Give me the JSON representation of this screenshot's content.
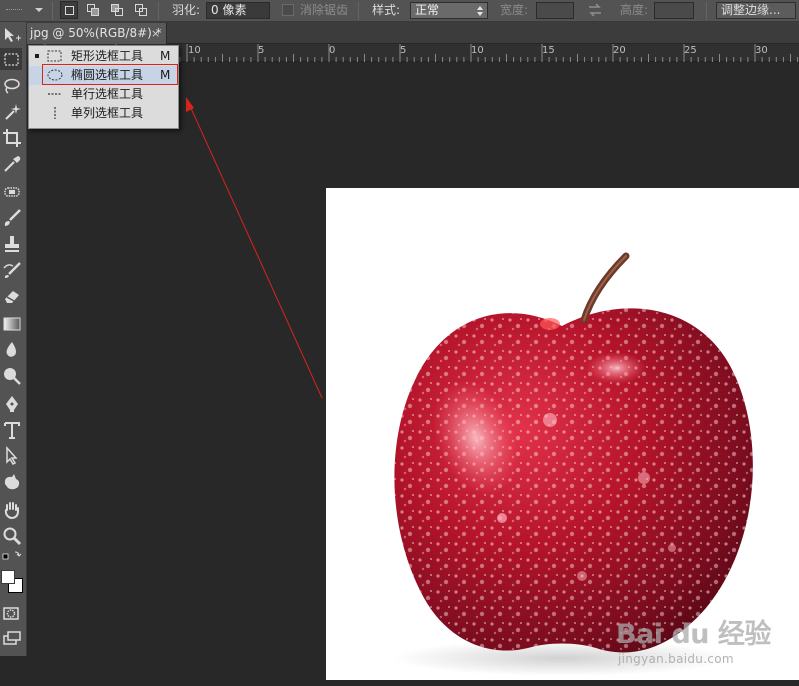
{
  "options_bar": {
    "feather_label": "羽化:",
    "feather_value": "0 像素",
    "antialias_label": "消除锯齿",
    "style_label": "样式:",
    "style_value": "正常",
    "width_label": "宽度:",
    "height_label": "高度:",
    "refine_edge_label": "调整边缘..."
  },
  "document_tab": {
    "title": "jpg @ 50%(RGB/8#) *",
    "close_glyph": "×"
  },
  "ruler": {
    "labels": [
      "10",
      "5",
      "0",
      "5",
      "10",
      "15",
      "20",
      "25",
      "30"
    ]
  },
  "flyout_menu": {
    "items": [
      {
        "label": "矩形选框工具",
        "shortcut": "M",
        "icon": "rect-marquee-icon",
        "current": true
      },
      {
        "label": "椭圆选框工具",
        "shortcut": "M",
        "icon": "ellipse-marquee-icon",
        "current": false,
        "highlighted": true
      },
      {
        "label": "单行选框工具",
        "shortcut": "",
        "icon": "single-row-marquee-icon",
        "current": false
      },
      {
        "label": "单列选框工具",
        "shortcut": "",
        "icon": "single-column-marquee-icon",
        "current": false
      }
    ]
  },
  "tools": [
    "move-tool-icon",
    "marquee-tool-icon",
    "lasso-tool-icon",
    "magic-wand-icon",
    "crop-tool-icon",
    "eyedropper-icon",
    "healing-brush-icon",
    "brush-tool-icon",
    "clone-stamp-icon",
    "history-brush-icon",
    "eraser-icon",
    "gradient-tool-icon",
    "blur-tool-icon",
    "dodge-tool-icon",
    "pen-tool-icon",
    "type-tool-icon",
    "path-selection-icon",
    "shape-tool-icon",
    "hand-tool-icon",
    "zoom-tool-icon"
  ],
  "colors": {
    "annotation_red": "#d9241e",
    "apple_red": "#b5142a",
    "panel_gray": "#535353",
    "canvas_gray": "#282828"
  },
  "watermark": {
    "brand": "Bai du 经验",
    "url": "jingyan.baidu.com"
  }
}
